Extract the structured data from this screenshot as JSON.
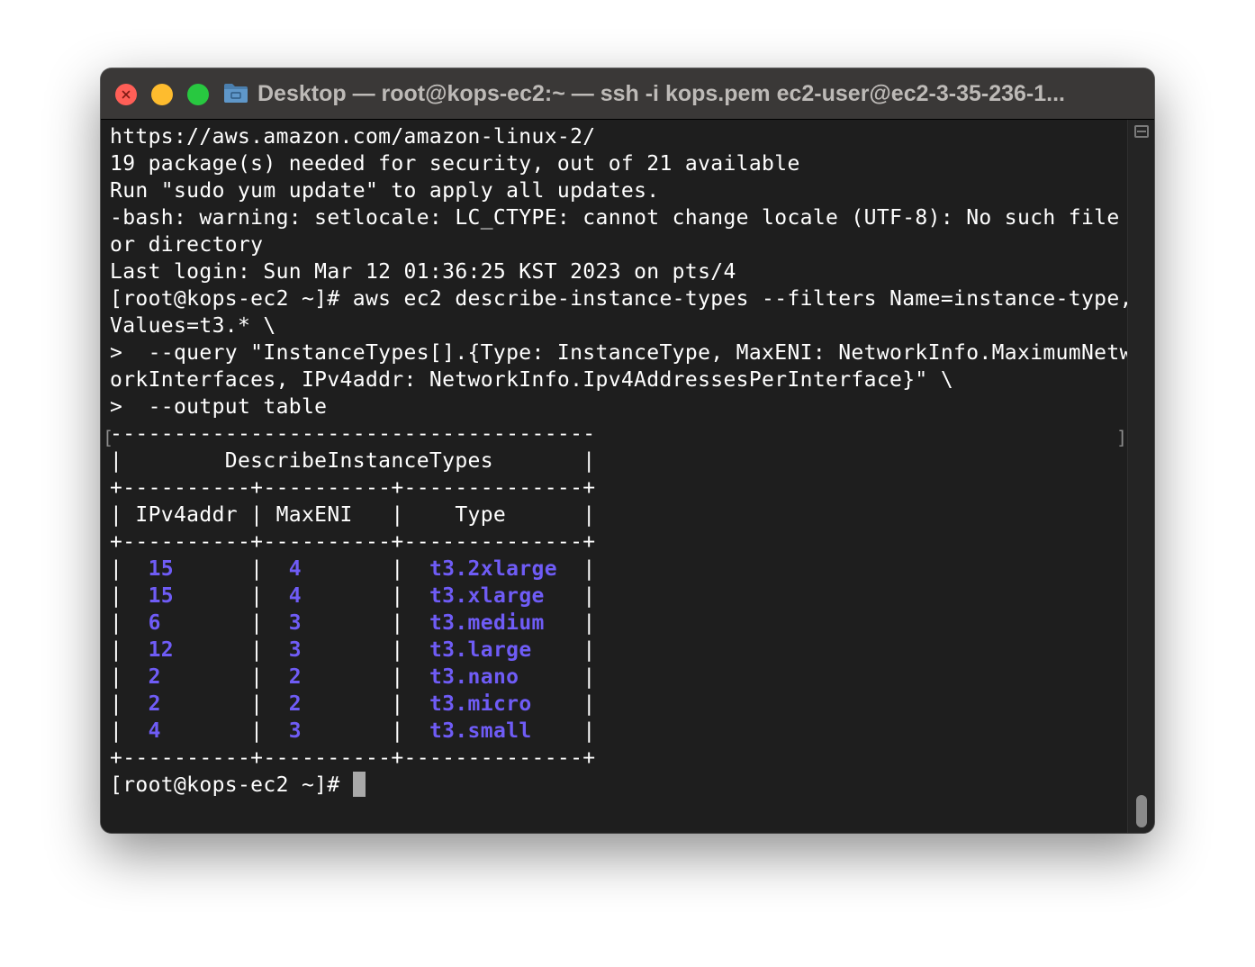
{
  "window": {
    "title": "Desktop — root@kops-ec2:~ — ssh -i kops.pem ec2-user@ec2-3-35-236-1..."
  },
  "terminal": {
    "lines": [
      "https://aws.amazon.com/amazon-linux-2/",
      "19 package(s) needed for security, out of 21 available",
      "Run \"sudo yum update\" to apply all updates.",
      "-bash: warning: setlocale: LC_CTYPE: cannot change locale (UTF-8): No such file",
      "or directory",
      "Last login: Sun Mar 12 01:36:25 KST 2023 on pts/4",
      "[root@kops-ec2 ~]# aws ec2 describe-instance-types --filters Name=instance-type,",
      "Values=t3.* \\",
      ">  --query \"InstanceTypes[].{Type: InstanceType, MaxENI: NetworkInfo.MaximumNetw",
      "orkInterfaces, IPv4addr: NetworkInfo.Ipv4AddressesPerInterface}\" \\",
      ">  --output table",
      "--------------------------------------",
      "|        DescribeInstanceTypes       |",
      "+----------+----------+--------------+",
      "| IPv4addr | MaxENI   |    Type      |",
      "+----------+----------+--------------+"
    ],
    "table_rows": [
      {
        "ipv4addr": "15",
        "maxeni": "4",
        "type": "t3.2xlarge"
      },
      {
        "ipv4addr": "15",
        "maxeni": "4",
        "type": "t3.xlarge"
      },
      {
        "ipv4addr": "6",
        "maxeni": "3",
        "type": "t3.medium"
      },
      {
        "ipv4addr": "12",
        "maxeni": "3",
        "type": "t3.large"
      },
      {
        "ipv4addr": "2",
        "maxeni": "2",
        "type": "t3.nano"
      },
      {
        "ipv4addr": "2",
        "maxeni": "2",
        "type": "t3.micro"
      },
      {
        "ipv4addr": "4",
        "maxeni": "3",
        "type": "t3.small"
      }
    ],
    "table_bottom": "+----------+----------+--------------+",
    "prompt": "[root@kops-ec2 ~]# ",
    "bracket_left": "[",
    "bracket_right": "]",
    "highlight_color": "#6f5cf6"
  }
}
